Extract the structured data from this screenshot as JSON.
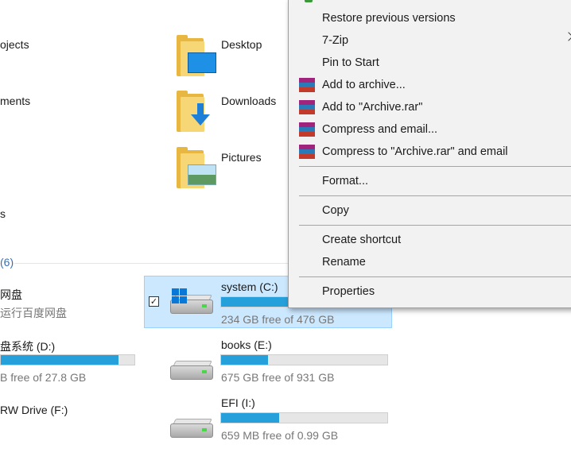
{
  "left_partial": {
    "projects": "ojects",
    "documents": "ments",
    "downloads_s": "s",
    "devices_count": "(6)",
    "baidu_title": "网盘",
    "baidu_sub": "运行百度网盘",
    "d_drive_name": "盘系统 (D:)",
    "d_drive_free": "B free of 27.8 GB",
    "d_drive_fill": 0.88,
    "f_drive_name": "RW Drive (F:)"
  },
  "folders": [
    {
      "label": "Desktop",
      "icon": "desktop-folder-icon"
    },
    {
      "label": "Downloads",
      "icon": "downloads-folder-icon"
    },
    {
      "label": "Pictures",
      "icon": "pictures-folder-icon"
    }
  ],
  "drives": [
    {
      "name": "system (C:)",
      "free": "234 GB free of 476 GB",
      "used_fraction": 0.51,
      "selected": true,
      "icon": "windows-drive-icon"
    },
    {
      "name": "books (E:)",
      "free": "675 GB free of 931 GB",
      "used_fraction": 0.28,
      "selected": false,
      "icon": "hard-drive-icon"
    },
    {
      "name": "EFI (I:)",
      "free": "659 MB free of 0.99 GB",
      "used_fraction": 0.35,
      "selected": false,
      "icon": "hard-drive-icon"
    }
  ],
  "context_menu": {
    "items": [
      {
        "label": "Restore previous versions"
      },
      {
        "label": "7-Zip",
        "submenu": true
      },
      {
        "label": "Pin to Start"
      },
      {
        "label": "Add to archive...",
        "icon": "winrar-icon"
      },
      {
        "label": "Add to \"Archive.rar\"",
        "icon": "winrar-icon"
      },
      {
        "label": "Compress and email...",
        "icon": "winrar-icon"
      },
      {
        "label": "Compress to \"Archive.rar\" and email",
        "icon": "winrar-icon"
      },
      {
        "label": "Format..."
      },
      {
        "label": "Copy"
      },
      {
        "label": "Create shortcut"
      },
      {
        "label": "Rename"
      },
      {
        "label": "Properties"
      }
    ]
  },
  "colors": {
    "accent_fill": "#26a0da",
    "selection_bg": "#cce8ff",
    "menu_bg": "#f2f2f2"
  }
}
